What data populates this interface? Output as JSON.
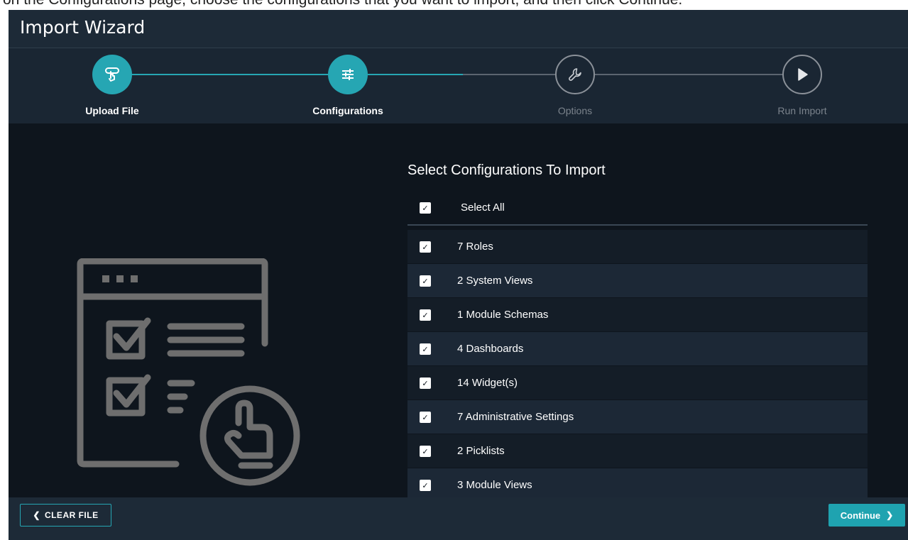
{
  "top_strip": {
    "text": "on the Configurations page, choose the configurations that you want to import, and then click Continue."
  },
  "wizard": {
    "title": "Import Wizard"
  },
  "steps": [
    {
      "label": "Upload File",
      "state": "done",
      "icon": "upload-hand-icon"
    },
    {
      "label": "Configurations",
      "state": "done",
      "icon": "sliders-icon"
    },
    {
      "label": "Options",
      "state": "pending",
      "icon": "wrench-icon"
    },
    {
      "label": "Run Import",
      "state": "pending",
      "icon": "play-icon"
    }
  ],
  "section": {
    "title": "Select Configurations To Import",
    "select_all": {
      "label": "Select All",
      "checked": true
    }
  },
  "configurations": [
    {
      "label": "7 Roles",
      "checked": true
    },
    {
      "label": "2 System Views",
      "checked": true
    },
    {
      "label": "1 Module Schemas",
      "checked": true
    },
    {
      "label": "4 Dashboards",
      "checked": true
    },
    {
      "label": "14 Widget(s)",
      "checked": true
    },
    {
      "label": "7 Administrative Settings",
      "checked": true
    },
    {
      "label": "2 Picklists",
      "checked": true
    },
    {
      "label": "3 Module Views",
      "checked": true
    }
  ],
  "footer": {
    "clear_label": "CLEAR FILE",
    "continue_label": "Continue"
  },
  "colors": {
    "accent": "#26a6b3",
    "header_bg": "#1d2a37",
    "body_bg": "#0e151d",
    "pending_step": "#8a9098"
  }
}
